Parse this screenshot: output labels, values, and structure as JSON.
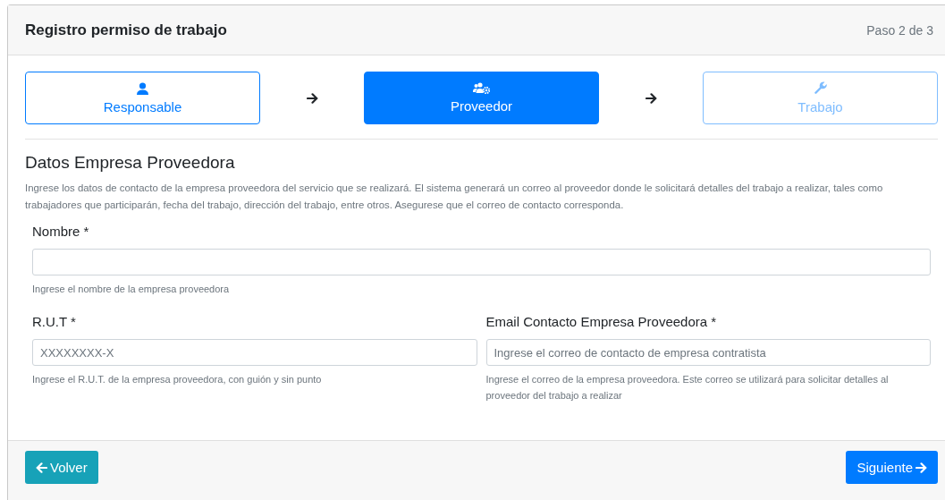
{
  "header": {
    "title": "Registro permiso de trabajo",
    "step_counter": "Paso 2 de 3"
  },
  "steps": [
    {
      "label": "Responsable",
      "selected": false,
      "disabled": false
    },
    {
      "label": "Proveedor",
      "selected": true,
      "disabled": false
    },
    {
      "label": "Trabajo",
      "selected": false,
      "disabled": true
    }
  ],
  "section": {
    "title": "Datos Empresa Proveedora",
    "description": "Ingrese los datos de contacto de la empresa proveedora del servicio que se realizará. El sistema generará un correo al proveedor donde le solicitará detalles del trabajo a realizar, tales como trabajadores que participarán, fecha del trabajo, dirección del trabajo, entre otros. Asegurese que el correo de contacto corresponda."
  },
  "fields": [
    {
      "label": "Nombre *",
      "help": "Ingrese el nombre de la empresa proveedora"
    }
  ],
  "field_row": [
    {
      "label": "R.U.T *",
      "placeholder": "XXXXXXXX-X",
      "help": "Ingrese el R.U.T. de la empresa proveedora, con guión y sin punto"
    },
    {
      "label": "Email Contacto Empresa Proveedora *",
      "placeholder": "Ingrese el correo de contacto de empresa contratista",
      "help": "Ingrese el correo de la empresa proveedora. Este correo se utilizará para solicitar detalles al proveedor del trabajo a realizar"
    }
  ],
  "footer": {
    "back_button": "Volver",
    "next_button": "Siguiente"
  }
}
